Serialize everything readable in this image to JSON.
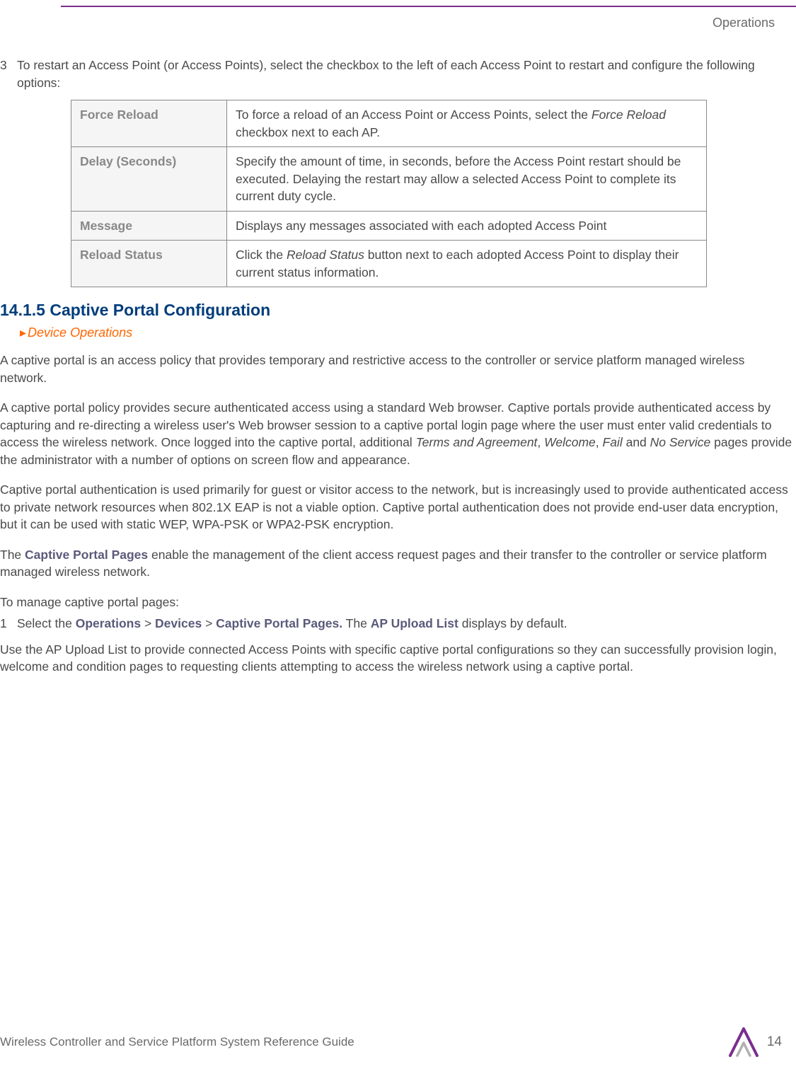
{
  "header": {
    "label": "Operations"
  },
  "step3": {
    "num": "3",
    "text": "To restart an Access Point (or Access Points), select the checkbox to the left of each Access Point to restart and configure the following options:"
  },
  "table": {
    "rows": [
      {
        "label": "Force Reload",
        "desc_pre": "To force a reload of an Access Point or Access Points, select the ",
        "desc_italic": "Force Reload",
        "desc_post": " checkbox next to each AP."
      },
      {
        "label": "Delay (Seconds)",
        "desc_pre": "Specify the amount of time, in seconds, before the Access Point restart should be executed. Delaying the restart may allow a selected Access Point to complete its current duty cycle.",
        "desc_italic": "",
        "desc_post": ""
      },
      {
        "label": "Message",
        "desc_pre": "Displays any messages associated with each adopted Access Point",
        "desc_italic": "",
        "desc_post": ""
      },
      {
        "label": "Reload Status",
        "desc_pre": "Click the ",
        "desc_italic": "Reload Status",
        "desc_post": " button next to each adopted Access Point to display their current status information."
      }
    ]
  },
  "section": {
    "heading": "14.1.5 Captive Portal Configuration",
    "breadcrumb": "Device Operations"
  },
  "paras": {
    "p1": "A captive portal is an access policy that provides temporary and restrictive access to the controller or service platform managed wireless network.",
    "p2_pre": "A captive portal policy provides secure authenticated access using a standard Web browser. Captive portals provide authenticated access by capturing and re-directing a wireless user's Web browser session to a captive portal login page where the user must enter valid credentials to access the wireless network. Once logged into the captive portal, additional ",
    "p2_i1": "Terms and Agreement",
    "p2_s1": ", ",
    "p2_i2": "Welcome",
    "p2_s2": ", ",
    "p2_i3": "Fail",
    "p2_s3": " and ",
    "p2_i4": "No Service",
    "p2_post": " pages provide the administrator with a number of options on screen flow and appearance.",
    "p3": "Captive portal authentication is used primarily for guest or visitor access to the network, but is increasingly used to provide authenticated access to private network resources when 802.1X EAP is not a viable option. Captive portal authentication does not provide end-user data encryption, but it can be used with static WEP, WPA-PSK or WPA2-PSK encryption.",
    "p4_pre": "The ",
    "p4_bold": "Captive Portal Pages",
    "p4_post": " enable the management of the client access request pages and their transfer to the controller or service platform managed wireless network.",
    "p5": "To manage captive portal pages:"
  },
  "step1b": {
    "num": "1",
    "pre": "Select the ",
    "b1": "Operations",
    "s1": " > ",
    "b2": "Devices",
    "s2": " > ",
    "b3": "Captive Portal Pages.",
    "mid": " The ",
    "b4": "AP Upload List",
    "post": " displays by default."
  },
  "paras2": {
    "p6": "Use the AP Upload List to provide connected Access Points with specific captive portal configurations so they can successfully provision login, welcome and condition pages to requesting clients attempting to access the wireless network using a captive portal."
  },
  "footer": {
    "text": "Wireless Controller and Service Platform System Reference Guide",
    "page": "14"
  }
}
